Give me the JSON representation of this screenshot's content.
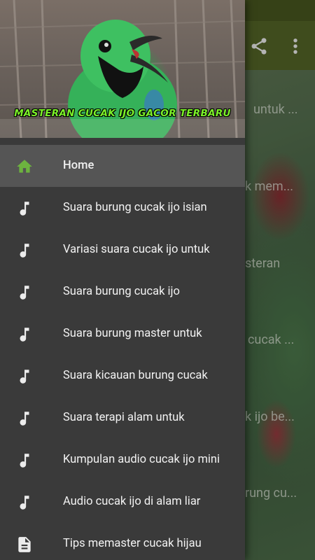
{
  "background_screen": {
    "list_fragments": [
      "untuk ...",
      "k mem...",
      "steran",
      "cucak ...",
      "k ijo be...",
      "rung cu..."
    ]
  },
  "drawer": {
    "header": {
      "caption": "MASTERAN CUCAK IJO GACOR TERBARU",
      "image_subject": "green-bird-photo"
    },
    "items": [
      {
        "label": "Home",
        "icon": "home-icon",
        "active": true
      },
      {
        "label": "Suara burung cucak ijo isian",
        "icon": "music-note-icon"
      },
      {
        "label": "Variasi suara cucak ijo untuk",
        "icon": "music-note-icon"
      },
      {
        "label": "Suara burung cucak ijo",
        "icon": "music-note-icon"
      },
      {
        "label": "Suara burung master untuk",
        "icon": "music-note-icon"
      },
      {
        "label": "Suara kicauan burung cucak",
        "icon": "music-note-icon"
      },
      {
        "label": "Suara terapi alam untuk",
        "icon": "music-note-icon"
      },
      {
        "label": "Kumpulan audio cucak ijo mini",
        "icon": "music-note-icon"
      },
      {
        "label": "Audio cucak ijo di alam liar",
        "icon": "music-note-icon"
      },
      {
        "label": "Tips memaster cucak hijau",
        "icon": "document-icon"
      }
    ]
  },
  "colors": {
    "toolbar": "#556627",
    "status_bar": "#48571f",
    "drawer_bg": "#3a3a3a",
    "active_item_bg": "#555555",
    "home_icon": "#6db33f",
    "caption_text": "#7cf229"
  }
}
